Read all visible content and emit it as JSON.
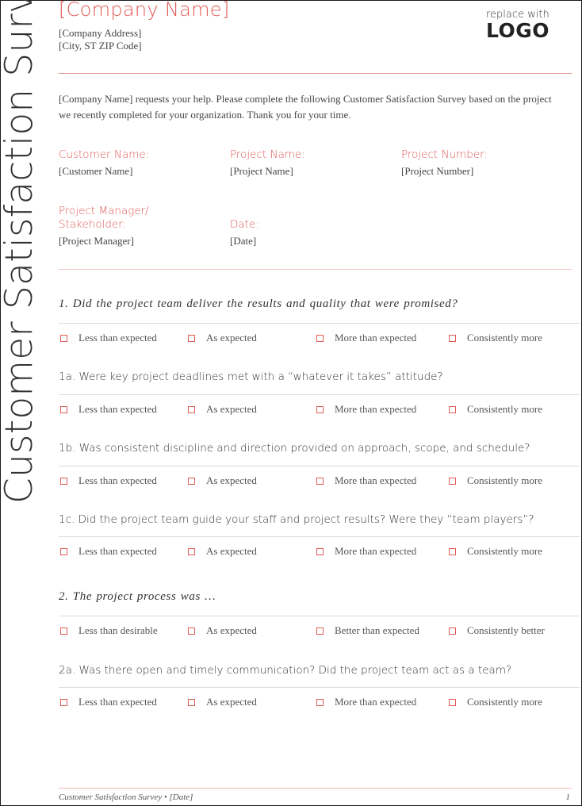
{
  "side_title": "Customer Satisfaction Survey",
  "header": {
    "company_name": "[Company Name]",
    "address": "[Company Address]",
    "city_state_zip": "[City, ST  ZIP Code]",
    "logo_small": "replace with",
    "logo_big": "LOGO"
  },
  "intro": "[Company Name] requests your help. Please complete the following Customer Satisfaction Survey based on the project we recently completed for your organization. Thank you for your time.",
  "fields": {
    "customer_name": {
      "label": "Customer Name:",
      "value": "[Customer Name]"
    },
    "project_name": {
      "label": "Project Name:",
      "value": "[Project Name]"
    },
    "project_number": {
      "label": "Project Number:",
      "value": "[Project Number]"
    },
    "project_manager": {
      "label_line1": "Project Manager/",
      "label_line2": "Stakeholder:",
      "value": "[Project Manager]"
    },
    "date": {
      "label": "Date:",
      "value": "[Date]"
    }
  },
  "questions": [
    {
      "text": "1.  Did the project team deliver the results and quality that were promised?",
      "options": [
        "Less than expected",
        "As expected",
        "More than expected",
        "Consistently more"
      ]
    },
    {
      "text": "1a. Were key project deadlines met with a “whatever it takes” attitude?",
      "options": [
        "Less than expected",
        "As expected",
        "More than expected",
        "Consistently more"
      ]
    },
    {
      "text": "1b. Was consistent discipline and direction provided on approach, scope, and schedule?",
      "options": [
        "Less than expected",
        "As expected",
        "More than expected",
        "Consistently more"
      ]
    },
    {
      "text": "1c. Did the project team guide your staff and project results? Were they “team players”?",
      "options": [
        "Less than expected",
        "As expected",
        "More than expected",
        "Consistently more"
      ]
    },
    {
      "text": "2.  The project process was …",
      "options": [
        "Less than desirable",
        "As expected",
        "Better than expected",
        "Consistently better"
      ]
    },
    {
      "text": "2a. Was there open and timely communication? Did the project team act as a team?",
      "options": [
        "Less than expected",
        "As expected",
        "More than expected",
        "Consistently more"
      ]
    }
  ],
  "footer": {
    "text": "Customer Satisfaction Survey • [Date]",
    "page_number": "1"
  },
  "colors": {
    "accent": "#e05a55",
    "text": "#444444"
  }
}
